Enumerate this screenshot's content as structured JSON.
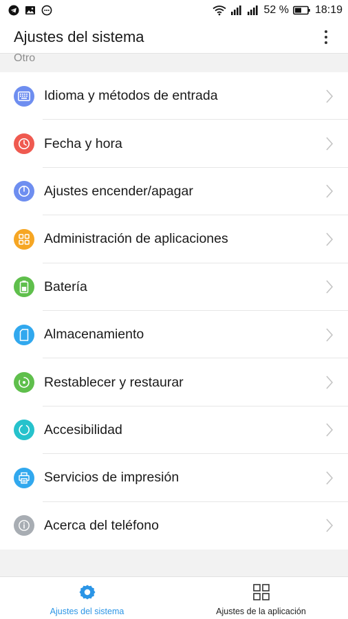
{
  "status_bar": {
    "battery_percent": "52 %",
    "time": "18:19",
    "left_icons": [
      "telegram-icon",
      "image-icon",
      "chat-bubble-icon"
    ],
    "right_icons": [
      "wifi-icon",
      "signal-icon",
      "signal-icon",
      "battery-icon"
    ]
  },
  "header": {
    "title": "Ajustes del sistema",
    "menu_icon": "more-vertical-icon"
  },
  "section": {
    "label": "Otro"
  },
  "settings": [
    {
      "label": "Idioma y métodos de entrada",
      "icon": "keyboard-icon",
      "color": "#6e8ef0"
    },
    {
      "label": "Fecha y hora",
      "icon": "clock-icon",
      "color": "#ef5a50"
    },
    {
      "label": "Ajustes encender/apagar",
      "icon": "power-icon",
      "color": "#6e8ef0"
    },
    {
      "label": "Administración de aplicaciones",
      "icon": "apps-grid-icon",
      "color": "#f6a623"
    },
    {
      "label": "Batería",
      "icon": "battery-icon",
      "color": "#5fbf4c"
    },
    {
      "label": "Almacenamiento",
      "icon": "sd-card-icon",
      "color": "#31a8ee"
    },
    {
      "label": "Restablecer y restaurar",
      "icon": "restore-icon",
      "color": "#5fbf4c"
    },
    {
      "label": "Accesibilidad",
      "icon": "accessibility-icon",
      "color": "#26c2cc"
    },
    {
      "label": "Servicios de impresión",
      "icon": "printer-icon",
      "color": "#31a8ee"
    },
    {
      "label": "Acerca del teléfono",
      "icon": "info-icon",
      "color": "#a8adb3"
    }
  ],
  "bottom_nav": {
    "items": [
      {
        "label": "Ajustes del sistema",
        "icon": "gear-icon",
        "active": true,
        "active_color": "#2b95e6"
      },
      {
        "label": "Ajustes de la aplicación",
        "icon": "grid-icon",
        "active": false
      }
    ]
  }
}
